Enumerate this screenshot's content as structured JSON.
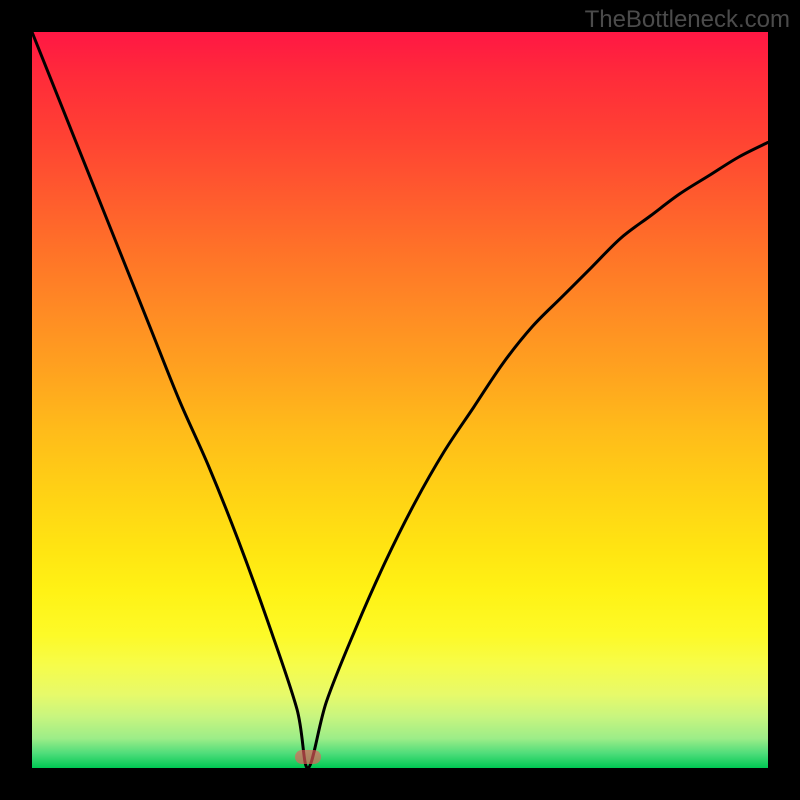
{
  "watermark": "TheBottleneck.com",
  "chart_data": {
    "type": "line",
    "title": "",
    "xlabel": "",
    "ylabel": "",
    "xlim": [
      0,
      100
    ],
    "ylim": [
      0,
      100
    ],
    "grid": false,
    "series": [
      {
        "name": "bottleneck-curve",
        "x": [
          0,
          4,
          8,
          12,
          16,
          20,
          24,
          28,
          32,
          36,
          37.5,
          40,
          44,
          48,
          52,
          56,
          60,
          64,
          68,
          72,
          76,
          80,
          84,
          88,
          92,
          96,
          100
        ],
        "values": [
          100,
          90,
          80,
          70,
          60,
          50,
          41,
          31,
          20,
          8,
          0,
          9,
          19,
          28,
          36,
          43,
          49,
          55,
          60,
          64,
          68,
          72,
          75,
          78,
          80.5,
          83,
          85
        ]
      }
    ],
    "annotations": [
      {
        "name": "min-marker",
        "x": 37.5,
        "y": 1.5
      }
    ],
    "background": {
      "type": "vertical-gradient",
      "stops": [
        {
          "pos": 0,
          "color": "#ff1744"
        },
        {
          "pos": 50,
          "color": "#ffbb1a"
        },
        {
          "pos": 85,
          "color": "#fdfa28"
        },
        {
          "pos": 100,
          "color": "#00c853"
        }
      ]
    }
  }
}
